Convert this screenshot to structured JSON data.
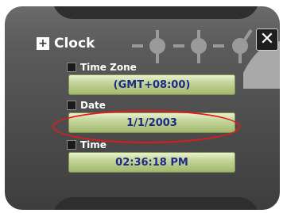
{
  "window": {
    "title": "Clock",
    "title_icon": "plus-icon",
    "close_icon": "close-icon",
    "close_glyph": "✕"
  },
  "fields": {
    "timezone": {
      "label": "Time Zone",
      "value": "(GMT+08:00)"
    },
    "date": {
      "label": "Date",
      "value": "1/1/2003"
    },
    "time": {
      "label": "Time",
      "value": "02:36:18 PM"
    }
  },
  "colors": {
    "field_text": "#1d2a86",
    "highlight": "#e21a1a",
    "panel": "#4c4c4c"
  }
}
